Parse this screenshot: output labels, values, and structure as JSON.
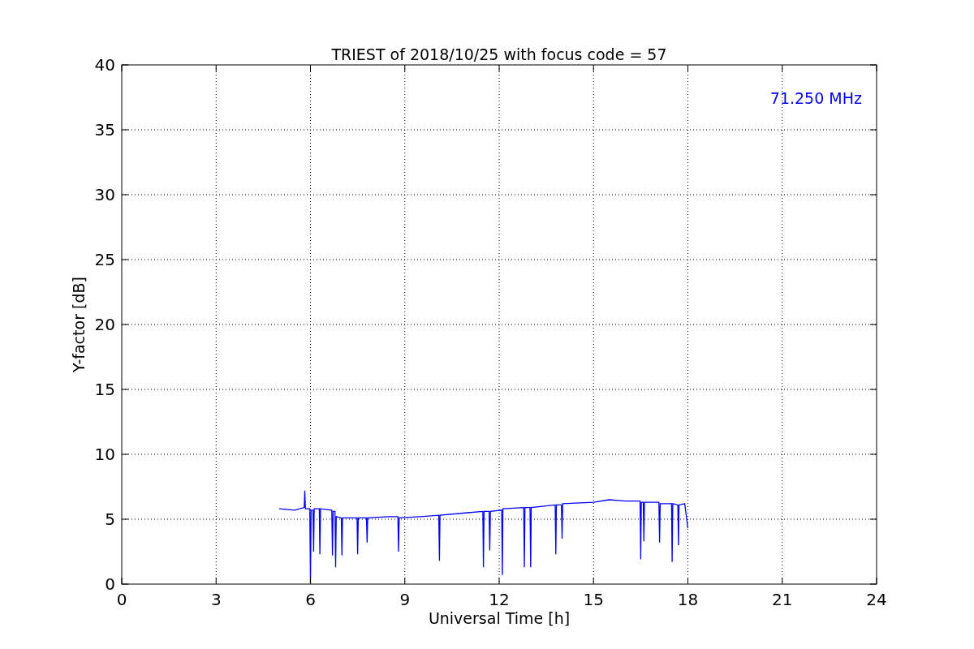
{
  "chart_data": {
    "type": "line",
    "title": "TRIEST of 2018/10/25 with focus code = 57",
    "xlabel": "Universal Time [h]",
    "ylabel": "Y-factor [dB]",
    "x": [
      5.0,
      5.5,
      5.8,
      5.82,
      5.84,
      5.98,
      6.0,
      6.02,
      6.08,
      6.1,
      6.12,
      6.28,
      6.3,
      6.32,
      6.68,
      6.7,
      6.72,
      6.78,
      6.8,
      6.82,
      6.98,
      7.0,
      7.02,
      7.48,
      7.5,
      7.52,
      7.78,
      7.8,
      7.82,
      8.5,
      8.78,
      8.8,
      8.82,
      9.5,
      10.08,
      10.1,
      10.12,
      11.0,
      11.48,
      11.5,
      11.52,
      11.68,
      11.7,
      11.72,
      12.08,
      12.1,
      12.12,
      12.78,
      12.8,
      12.82,
      12.98,
      13.0,
      13.02,
      13.78,
      13.8,
      13.82,
      13.98,
      14.0,
      14.02,
      15.0,
      15.5,
      16.0,
      16.48,
      16.5,
      16.52,
      16.58,
      16.6,
      16.62,
      17.08,
      17.1,
      17.12,
      17.48,
      17.5,
      17.52,
      17.68,
      17.7,
      17.72,
      17.9,
      18.0
    ],
    "series": [
      {
        "name": "71.250 MHz",
        "color": "#0000ff",
        "values": [
          5.8,
          5.7,
          5.9,
          7.2,
          5.8,
          5.8,
          0.0,
          5.7,
          5.7,
          2.5,
          5.8,
          5.8,
          2.3,
          5.8,
          5.7,
          2.2,
          5.6,
          5.6,
          1.3,
          5.2,
          5.1,
          2.2,
          5.1,
          5.1,
          2.3,
          5.1,
          5.1,
          3.2,
          5.1,
          5.2,
          5.2,
          2.5,
          5.1,
          5.2,
          5.3,
          1.8,
          5.3,
          5.5,
          5.6,
          1.3,
          5.6,
          5.6,
          2.6,
          5.6,
          5.7,
          0.7,
          5.8,
          5.9,
          1.3,
          5.9,
          5.9,
          1.3,
          5.9,
          6.1,
          2.3,
          6.1,
          6.1,
          3.5,
          6.2,
          6.3,
          6.5,
          6.4,
          6.4,
          1.9,
          6.3,
          6.3,
          3.3,
          6.3,
          6.3,
          3.2,
          6.2,
          6.2,
          1.7,
          6.2,
          6.1,
          3.0,
          6.1,
          6.2,
          4.3
        ]
      }
    ],
    "xlim": [
      0,
      24
    ],
    "ylim": [
      0,
      40
    ],
    "xticks": [
      0,
      3,
      6,
      9,
      12,
      15,
      18,
      21,
      24
    ],
    "yticks": [
      0,
      5,
      10,
      15,
      20,
      25,
      30,
      35,
      40
    ],
    "grid": true
  }
}
